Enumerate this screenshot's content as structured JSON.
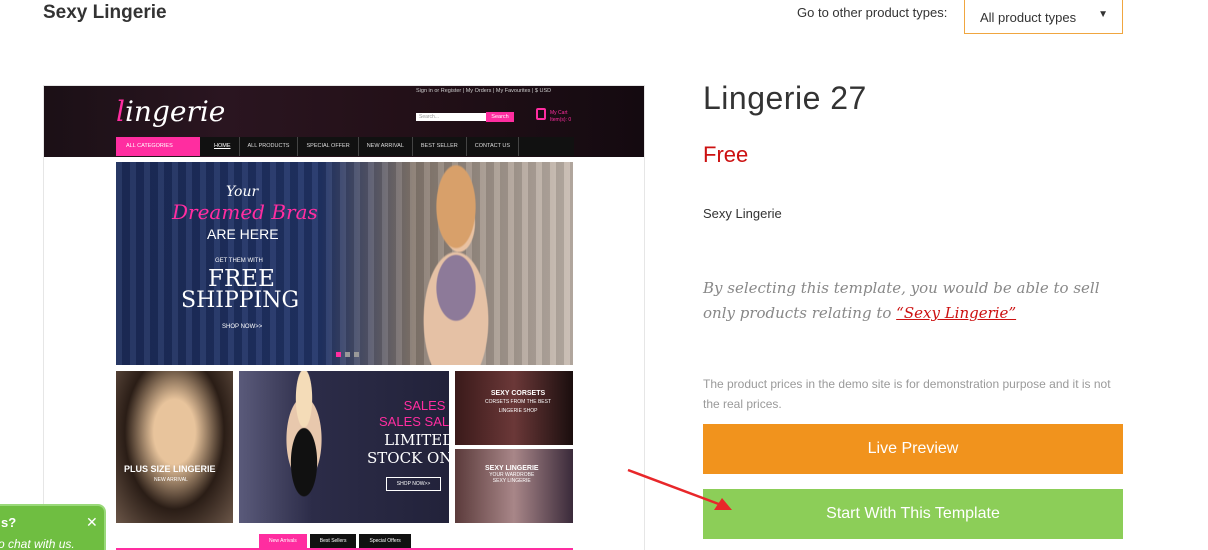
{
  "header": {
    "title": "Sexy Lingerie",
    "type_label": "Go to other product types:",
    "type_select": "All product types"
  },
  "preview": {
    "logo_first": "l",
    "logo_rest": "ingerie",
    "toplinks": "Sign in or Register  |  My Orders  |  My Favourites  |  $ USD",
    "search_placeholder": "Search...",
    "search_button": "Search",
    "cart": "My Cart",
    "cart_sub": "Item(s): 0",
    "nav_all": "ALL CATEGORIES",
    "nav": [
      "HOME",
      "ALL PRODUCTS",
      "SPECIAL OFFER",
      "NEW ARRIVAL",
      "BEST SELLER",
      "CONTACT US"
    ],
    "banner": {
      "your": "Your",
      "dreamed": "Dreamed Bras",
      "are_here": "ARE HERE",
      "get_them": "GET THEM WITH",
      "free": "FREE",
      "shipping": "SHIPPING",
      "shop_now": "SHOP NOW>>"
    },
    "tiles": {
      "plus_size": "PLUS SIZE LINGERIE",
      "new_arrival": "NEW ARRIVAL",
      "sales": "SALES",
      "sales2": "SALES SALES!",
      "limited": "LIMITED",
      "stock_only": "STOCK ONLY",
      "shop_now": "SHOP NOW>>",
      "corsets": "SEXY CORSETS",
      "corsets_sub": "CORSETS FROM THE BEST",
      "corsets_sub2": "LINGERIE SHOP",
      "sexy_lingerie": "SEXY LINGERIE",
      "sexy_sub": "YOUR WARDROBE",
      "sexy_sub2": "SEXY LINGERIE"
    },
    "tabs": [
      "New Arrivals",
      "Best Sellers",
      "Special Offers"
    ]
  },
  "product": {
    "title": "Lingerie 27",
    "price": "Free",
    "category": "Sexy Lingerie",
    "note_text": "By selecting this template, you would be able to sell only products relating to ",
    "note_link": "“Sexy Lingerie”",
    "disclaimer": "The product prices in the demo site is for demonstration purpose and it is not the real prices.",
    "live_preview": "Live Preview",
    "start_template": "Start With This Template"
  },
  "chat": {
    "title": "s?",
    "close": "✕",
    "sub": "o chat with us."
  },
  "colors": {
    "accent_orange": "#f1931d",
    "accent_green": "#8cce58",
    "price_red": "#cc1111",
    "pink": "#ff2da0"
  }
}
